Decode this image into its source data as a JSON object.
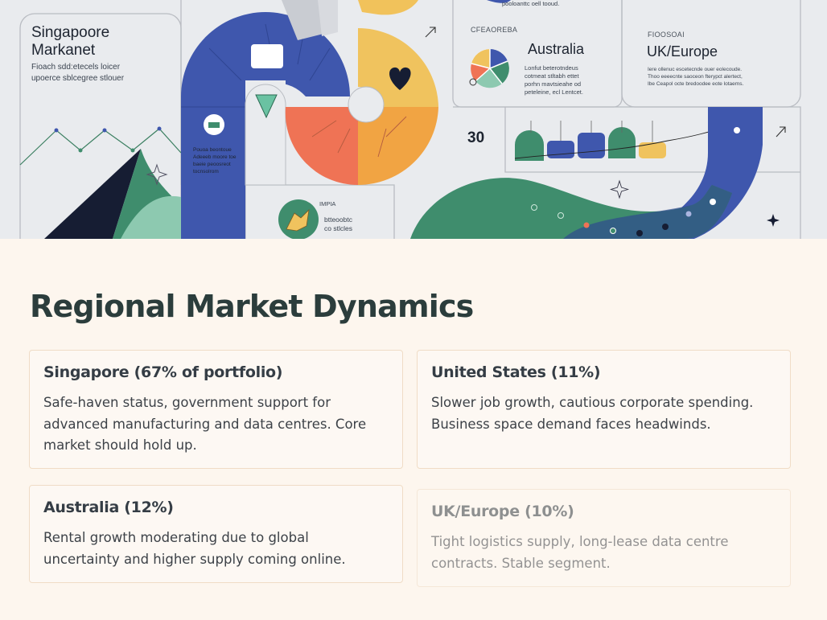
{
  "hero": {
    "panels": {
      "singapore": {
        "title_line1": "Singapoore",
        "title_line2": "Markanet",
        "desc_line1": "Fioach sdd:etecels loicer",
        "desc_line2": "upoerce sblcegree stlouer"
      },
      "australia": {
        "caption": "CFEAOREBA",
        "title": "Australia",
        "desc_lines": [
          "Lonfut beterotndeus",
          "cotmeat stltabh ettet",
          "porhn mavtsieahe od",
          "peteleine, ecl Lentcet."
        ]
      },
      "uk": {
        "caption": "FIOOSOAI",
        "title": "UK/Europe",
        "desc_lines": [
          "Iere ollenuc escetecnde ouer eolecoude.",
          "Thoo eeeecnte saoceon fterypct alertect,",
          "Ibe Ceapol octe bredoodee eote lotaems."
        ]
      },
      "top_snippet": "pooloanttc oell tooud.",
      "stat_number": "30",
      "left_tiny_lines": [
        "Pouoa beontoue",
        "Adeeeb moore toe",
        "baeie peoosreot",
        "tocnsolrom"
      ],
      "bottom_caption": "IMPIA",
      "bottom_lines": [
        "btteoobtc",
        "co stlcles"
      ]
    },
    "colors": {
      "blue": "#3f57ad",
      "green": "#3f8d6d",
      "light_green": "#8dc9b0",
      "coral": "#ef7355",
      "orange": "#f1a443",
      "yellow": "#f0c35e",
      "navy": "#161d33"
    },
    "icons": [
      "heart-icon",
      "arrow-up-right-icon",
      "sparkle-icon",
      "pie-chart-icon",
      "dog-icon",
      "building-icon"
    ]
  },
  "section": {
    "title": "Regional Market Dynamics",
    "cards": [
      {
        "title": "Singapore (67% of portfolio)",
        "body": "Safe-haven status, government support for advanced manufacturing and data centres. Core market should hold up."
      },
      {
        "title": "United States (11%)",
        "body": "Slower job growth, cautious corporate spending. Business space demand faces headwinds."
      },
      {
        "title": "Australia (12%)",
        "body": "Rental growth moderating due to global uncertainty and higher supply coming online."
      },
      {
        "title": "UK/Europe (10%)",
        "body": "Tight logistics supply, long-lease data centre contracts. Stable segment."
      }
    ]
  }
}
